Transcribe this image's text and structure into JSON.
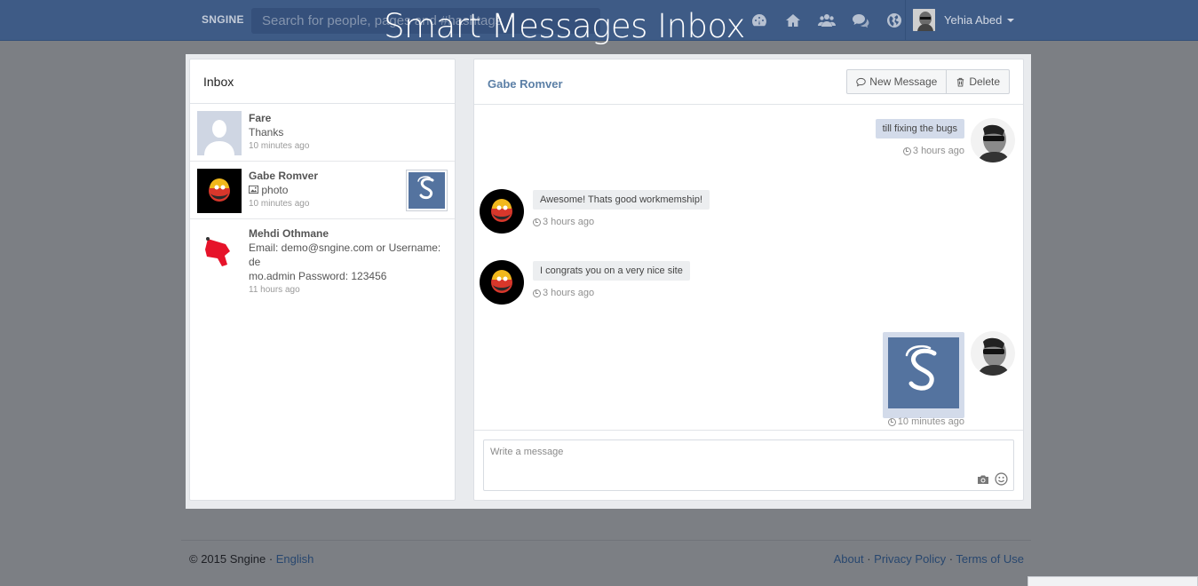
{
  "navbar": {
    "brand": "SNGINE",
    "search_placeholder": "Search for people, pages and #hashtags",
    "user_name": "Yehia Abed",
    "icons": [
      "dashboard-icon",
      "home-icon",
      "friends-icon",
      "chat-icon",
      "globe-icon"
    ]
  },
  "overlay_title": "Smart Messages Inbox",
  "inbox": {
    "title": "Inbox",
    "conversations": [
      {
        "name": "Fare",
        "text": "Thanks",
        "time": "10 minutes ago"
      },
      {
        "name": "Gabe Romver",
        "text": "photo",
        "time": "10 minutes ago",
        "has_photo": true
      },
      {
        "name": "Mehdi Othmane",
        "text_line1": "Email: demo@sngine.com or Username: de",
        "text_line2": "mo.admin Password: 123456",
        "time": "11 hours ago"
      }
    ]
  },
  "chat": {
    "with": "Gabe Romver",
    "new_message_label": "New Message",
    "delete_label": "Delete",
    "messages": [
      {
        "direction": "out",
        "text": "till fixing the bugs",
        "time": "3 hours ago"
      },
      {
        "direction": "in",
        "text": "Awesome! Thats good workmemship!",
        "time": "3 hours ago"
      },
      {
        "direction": "in",
        "text": "I congrats you on a very nice site",
        "time": "3 hours ago"
      },
      {
        "direction": "out",
        "type": "photo",
        "time": "10 minutes ago"
      }
    ],
    "composer_placeholder": "Write a message"
  },
  "footer": {
    "copyright": "© 2015 Sngine · ",
    "language": "English",
    "links": [
      "About",
      "Privacy Policy",
      "Terms of Use"
    ],
    "separator": " · "
  },
  "colors": {
    "navbar": "#3e5b86",
    "accent_link": "#5b7fa6",
    "bubble_out": "#d3dbea",
    "bubble_in": "#eceef0"
  }
}
